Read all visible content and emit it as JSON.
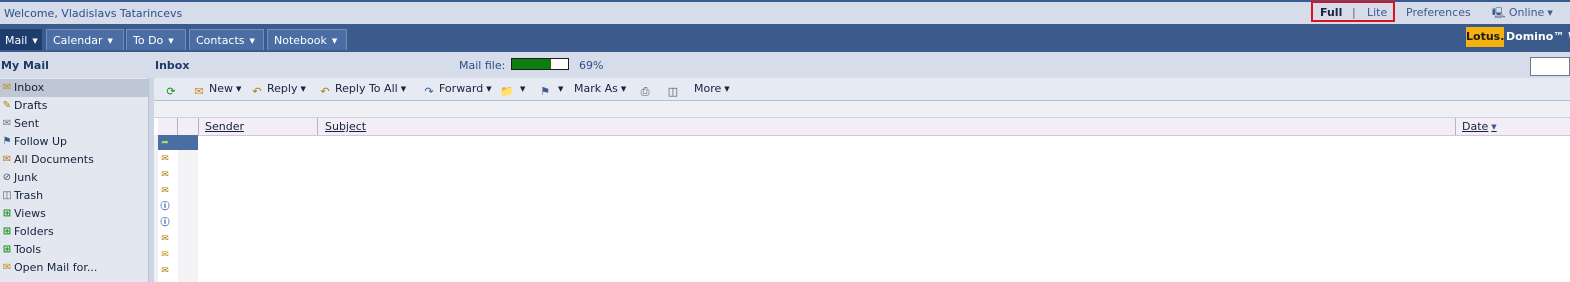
{
  "header": {
    "welcome": "Welcome, Vladislavs Tatarincevs",
    "mode_full": "Full",
    "mode_separator": "|",
    "mode_lite": "Lite",
    "preferences": "Preferences",
    "online": "Online"
  },
  "nav": {
    "tabs": [
      {
        "label": "Mail"
      },
      {
        "label": "Calendar"
      },
      {
        "label": "To Do"
      },
      {
        "label": "Contacts"
      },
      {
        "label": "Notebook"
      }
    ],
    "brand_lotus": "Lotus.",
    "brand_domino": "Domino™ We"
  },
  "info": {
    "my_mail": "My Mail",
    "view_title": "Inbox",
    "mail_file_label": "Mail file:",
    "mail_file_percent_text": "69%",
    "mail_file_fraction": 0.69
  },
  "sidebar": {
    "items": [
      {
        "label": "Inbox",
        "icon": "inbox-icon"
      },
      {
        "label": "Drafts",
        "icon": "drafts-icon"
      },
      {
        "label": "Sent",
        "icon": "sent-icon"
      },
      {
        "label": "Follow Up",
        "icon": "flag-icon"
      },
      {
        "label": "All Documents",
        "icon": "documents-icon"
      },
      {
        "label": "Junk",
        "icon": "junk-icon"
      },
      {
        "label": "Trash",
        "icon": "trash-icon"
      },
      {
        "label": "Views",
        "icon": "views-icon"
      },
      {
        "label": "Folders",
        "icon": "folders-icon"
      },
      {
        "label": "Tools",
        "icon": "tools-icon"
      },
      {
        "label": "Open Mail for...",
        "icon": "open-mail-icon"
      }
    ]
  },
  "toolbar": {
    "new": "New",
    "reply": "Reply",
    "reply_all": "Reply To All",
    "forward": "Forward",
    "mark_as": "Mark As",
    "more": "More"
  },
  "view": {
    "columns": {
      "sender": "Sender",
      "subject": "Subject",
      "date": "Date"
    },
    "row_icons": [
      "forward-icon",
      "envelope-icon",
      "envelope-icon",
      "envelope-icon",
      "info-icon",
      "info-icon",
      "envelope-icon",
      "envelope-open-icon",
      "envelope-icon"
    ]
  },
  "colors": {
    "nav_bar": "#3b5b8d",
    "top_bar": "#d6dcea",
    "highlight_box": "#e0111b",
    "quota_fill": "#0e7d10",
    "selected_row": "#4a6ea4"
  }
}
